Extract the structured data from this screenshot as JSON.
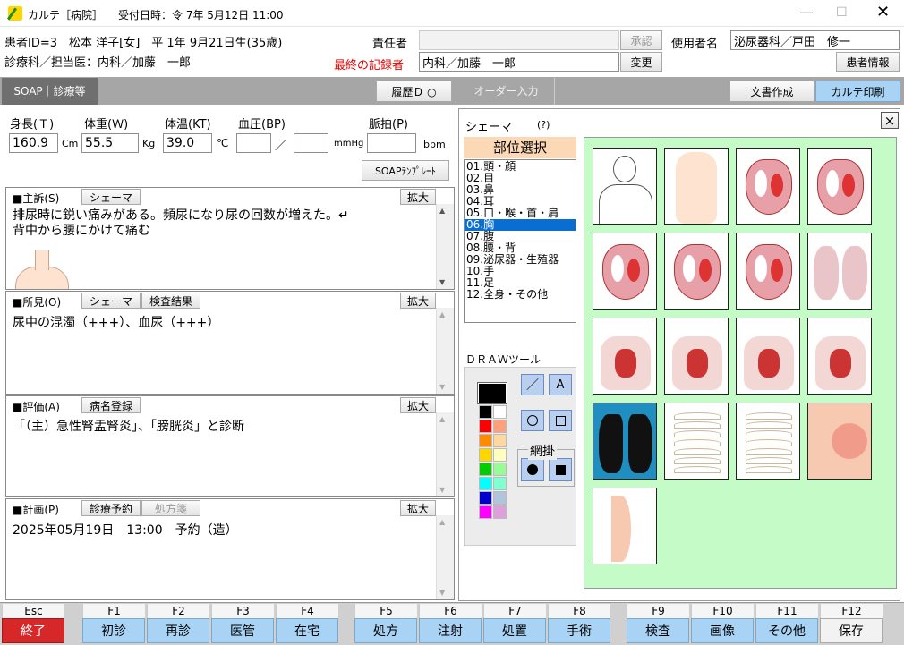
{
  "titlebar": {
    "app": "カルテ［病院］",
    "reception": "受付日時：令 7年 5月12日 11:00"
  },
  "patient": {
    "info": "患者ID=3　松本 洋子[女]　平 1年 9月21日生(35歳)",
    "dept": "診療科／担当医：内科／加藤　一郎"
  },
  "header": {
    "responsible_label": "責任者",
    "responsible_value": "",
    "approve": "承認",
    "user_label": "使用者名",
    "user_value": "泌尿器科／戸田　修一",
    "last_recorder_label": "最終の記録者",
    "last_recorder_value": "内科／加藤　一郎",
    "change": "変更",
    "patient_info_btn": "患者情報"
  },
  "tabs": {
    "soap": "SOAP｜診療等",
    "history": "履歴Ｄ ○",
    "order": "オーダー入力",
    "doc": "文書作成",
    "print": "カルテ印刷"
  },
  "vitals": {
    "height_label": "身長(Ｔ)",
    "weight_label": "体重(Ｗ)",
    "temp_label": "体温(KT)",
    "bp_label": "血圧(BP)",
    "pulse_label": "脈拍(P)",
    "height": "160.9",
    "height_unit": "Cm",
    "weight": "55.5",
    "weight_unit": "Kg",
    "temp": "39.0",
    "temp_unit": "℃",
    "bp_sep": "／",
    "bp_unit": "mmHg",
    "pulse_unit": "bpm",
    "template_btn": "SOAPﾃﾝﾌﾟﾚｰﾄ"
  },
  "s": {
    "title": "■主訴(S)",
    "schema": "シェーマ",
    "expand": "拡大",
    "text1": "排尿時に鋭い痛みがある。頻尿になり尿の回数が増えた。↵",
    "text2": "背中から腰にかけて痛む"
  },
  "o": {
    "title": "■所見(O)",
    "schema": "シェーマ",
    "results": "検査結果",
    "expand": "拡大",
    "text": "尿中の混濁（+++）、血尿（+++）"
  },
  "a": {
    "title": "■評価(A)",
    "register": "病名登録",
    "expand": "拡大",
    "text": "「（主）急性腎盂腎炎」、「膀胱炎」と診断"
  },
  "p": {
    "title": "■計画(P)",
    "appointment": "診療予約",
    "prescription": "処方箋",
    "expand": "拡大",
    "text": "2025年05月19日　13:00　予約（造）"
  },
  "schema": {
    "title": "シェーマ",
    "help": "(?)",
    "close": "×",
    "region_title": "部位選択",
    "regions": [
      "01.頭・顔",
      "02.目",
      "03.鼻",
      "04.耳",
      "05.口・喉・首・肩",
      "06.胸",
      "07.腹",
      "08.腰・背",
      "09.泌尿器・生殖器",
      "10.手",
      "11.足",
      "12.全身・その他"
    ],
    "selected_index": 5,
    "draw_title": "ＤＲＡＷツール",
    "line_tool": "／",
    "text_tool": "A",
    "fill_label": "網掛"
  },
  "palette": {
    "main": "#000000",
    "colors": [
      [
        "#000000",
        "#ffffff"
      ],
      [
        "#ff0000",
        "#ffa07a"
      ],
      [
        "#ff8c00",
        "#ffd7a0"
      ],
      [
        "#ffd700",
        "#ffffc0"
      ],
      [
        "#00cc00",
        "#98fb98"
      ],
      [
        "#00ffff",
        "#80ffd0"
      ],
      [
        "#0000cd",
        "#b0c4de"
      ],
      [
        "#ff00ff",
        "#dda0dd"
      ]
    ]
  },
  "fkeys": [
    {
      "k": "Esc",
      "b": "終了"
    },
    {
      "k": "F1",
      "b": "初診"
    },
    {
      "k": "F2",
      "b": "再診"
    },
    {
      "k": "F3",
      "b": "医管"
    },
    {
      "k": "F4",
      "b": "在宅"
    },
    {
      "k": "F5",
      "b": "処方"
    },
    {
      "k": "F6",
      "b": "注射"
    },
    {
      "k": "F7",
      "b": "処置"
    },
    {
      "k": "F8",
      "b": "手術"
    },
    {
      "k": "F9",
      "b": "検査"
    },
    {
      "k": "F10",
      "b": "画像"
    },
    {
      "k": "F11",
      "b": "その他"
    },
    {
      "k": "F12",
      "b": "保存"
    }
  ]
}
